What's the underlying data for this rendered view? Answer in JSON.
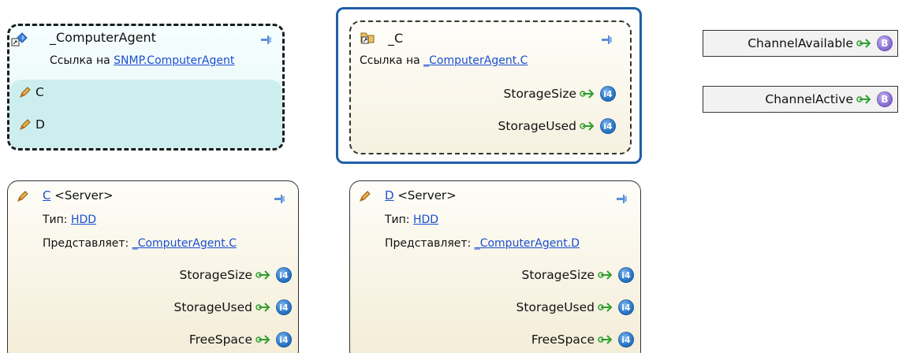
{
  "nodes": {
    "computer_agent": {
      "title": "_ComputerAgent",
      "ref_prefix": "Ссылка на ",
      "ref_link": "SNMP.ComputerAgent",
      "children": [
        "C",
        "D"
      ]
    },
    "c_ref": {
      "title": "_C",
      "ref_prefix": "Ссылка на ",
      "ref_link": "_ComputerAgent.C",
      "outputs": [
        {
          "label": "StorageSize",
          "type": "i4"
        },
        {
          "label": "StorageUsed",
          "type": "i4"
        }
      ]
    },
    "c_server": {
      "name": "C",
      "kind": " <Server>",
      "type_prefix": "Тип: ",
      "type_link": "HDD",
      "repr_prefix": "Представляет: ",
      "repr_link": "_ComputerAgent.C",
      "outputs": [
        {
          "label": "StorageSize",
          "type": "i4"
        },
        {
          "label": "StorageUsed",
          "type": "i4"
        },
        {
          "label": "FreeSpace",
          "type": "i4"
        }
      ]
    },
    "d_server": {
      "name": "D",
      "kind": " <Server>",
      "type_prefix": "Тип: ",
      "type_link": "HDD",
      "repr_prefix": "Представляет: ",
      "repr_link": "_ComputerAgent.D",
      "outputs": [
        {
          "label": "StorageSize",
          "type": "i4"
        },
        {
          "label": "StorageUsed",
          "type": "i4"
        },
        {
          "label": "FreeSpace",
          "type": "i4"
        }
      ]
    }
  },
  "variables": [
    {
      "label": "ChannelAvailable",
      "type": "B"
    },
    {
      "label": "ChannelActive",
      "type": "B"
    }
  ],
  "colors": {
    "link": "#1a4fd0",
    "selected_border": "#1f5fa8",
    "cyan_fill_top": "#eafbfb",
    "cyan_fill_bottom": "#cfeff0",
    "cream_fill_top": "#fefdf8",
    "cream_fill_bottom": "#f3ecd6",
    "badge_i4": "#2a76c8",
    "badge_b": "#8e72d8",
    "arrow_green": "#2f9e2f"
  },
  "icons": {
    "pin": "pin-icon",
    "pencil": "pencil-icon",
    "arrow": "green-arrow-icon",
    "agent": "agent-diamond-icon",
    "reference": "reference-folder-icon"
  }
}
